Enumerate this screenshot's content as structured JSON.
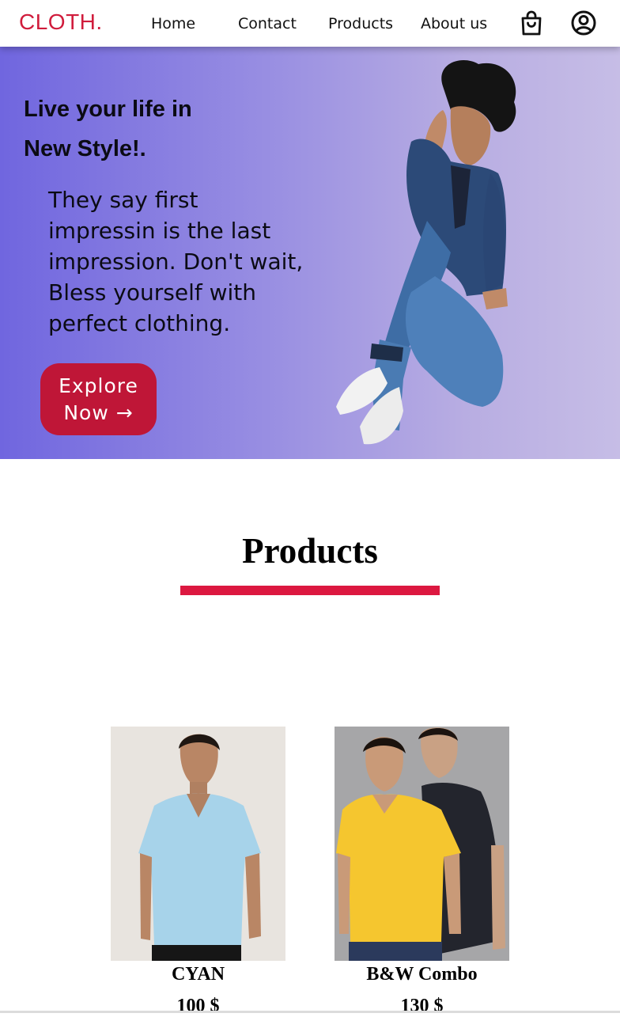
{
  "header": {
    "logo": "CLOTH.",
    "nav": [
      "Home",
      "Contact",
      "Products",
      "About us"
    ],
    "cart_icon": "shopping-bag-icon",
    "account_icon": "user-circle-icon"
  },
  "hero": {
    "title_line1": "Live your life in",
    "title_line2": "New Style!.",
    "text": "They say first impressin is the last impression. Don't wait, Bless yourself with perfect clothing.",
    "button_line1": "Explore",
    "button_line2": "Now →"
  },
  "products": {
    "heading": "Products",
    "items": [
      {
        "name": "CYAN",
        "price": "100 $"
      },
      {
        "name": "B&W Combo",
        "price": "130 $"
      }
    ]
  },
  "colors": {
    "brand": "#d01c3c",
    "button": "#bf1637",
    "underline": "#dc1840",
    "hero_gradient_start": "#7066df",
    "hero_gradient_end": "#c6bde6"
  }
}
